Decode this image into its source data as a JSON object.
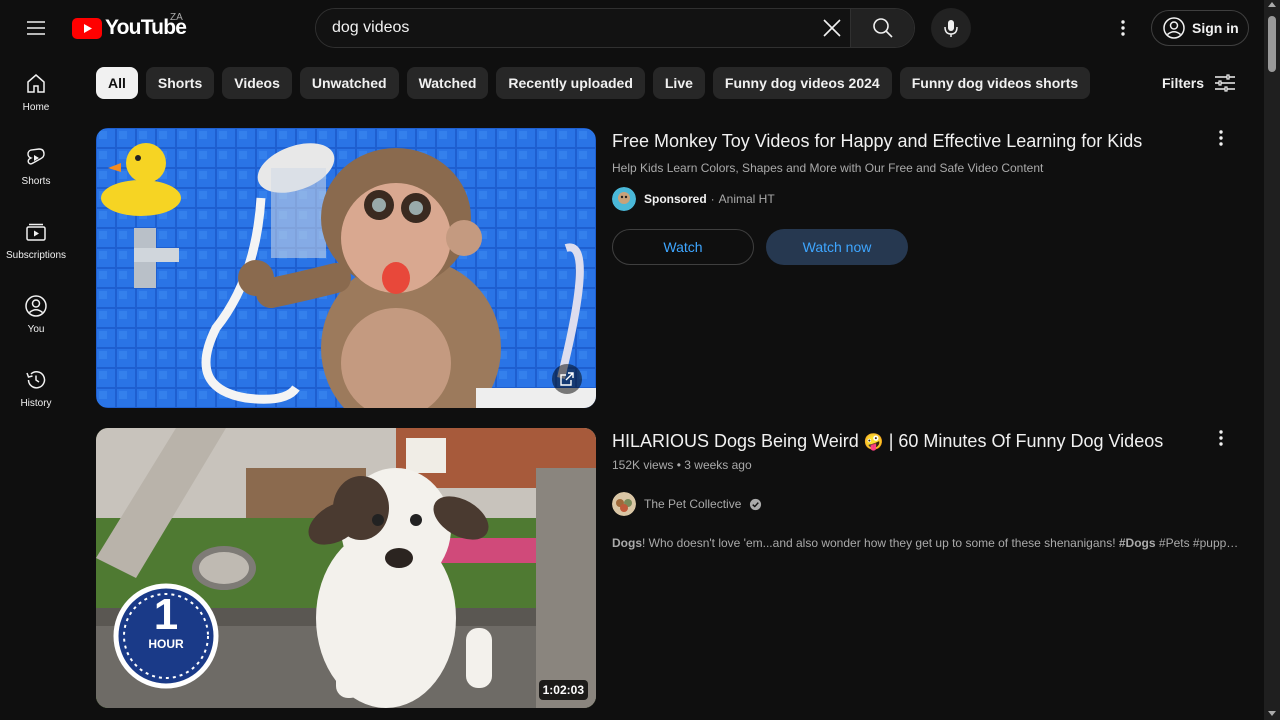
{
  "header": {
    "logo_text": "YouTube",
    "country_code": "ZA",
    "search_value": "dog videos",
    "signin_label": "Sign in"
  },
  "sidebar": {
    "items": [
      {
        "label": "Home",
        "icon": "home-icon"
      },
      {
        "label": "Shorts",
        "icon": "shorts-icon"
      },
      {
        "label": "Subscriptions",
        "icon": "subscriptions-icon"
      },
      {
        "label": "You",
        "icon": "you-icon"
      },
      {
        "label": "History",
        "icon": "history-icon"
      }
    ]
  },
  "chips": [
    "All",
    "Shorts",
    "Videos",
    "Unwatched",
    "Watched",
    "Recently uploaded",
    "Live",
    "Funny dog videos 2024",
    "Funny dog videos shorts"
  ],
  "filters_label": "Filters",
  "results": [
    {
      "title": "Free Monkey Toy Videos for Happy and Effective Learning for Kids",
      "description": "Help Kids Learn Colors, Shapes and More with Our Free and Safe Video Content",
      "sponsored_label": "Sponsored",
      "separator": "·",
      "advertiser": "Animal HT",
      "watch_label": "Watch",
      "watch_now_label": "Watch now"
    },
    {
      "title_part1": "HILARIOUS Dogs Being Weird",
      "title_emoji": "🤪",
      "title_part2": "| 60 Minutes Of Funny Dog Videos",
      "views": "152K views",
      "meta_sep": "•",
      "age": "3 weeks ago",
      "channel": "The Pet Collective",
      "snippet_bold1": "Dogs",
      "snippet_text1": "! Who doesn't love 'em...and also wonder how they get up to some of these shenanigans! ",
      "snippet_bold2": "#Dogs",
      "snippet_text2": " #Pets #puppy ...",
      "duration": "1:02:03",
      "badge_number": "1",
      "badge_word": "HOUR"
    }
  ],
  "colors": {
    "background": "#0f0f0f",
    "chip": "#272727",
    "link_blue": "#3ea6ff",
    "brand_red": "#ff0000"
  }
}
